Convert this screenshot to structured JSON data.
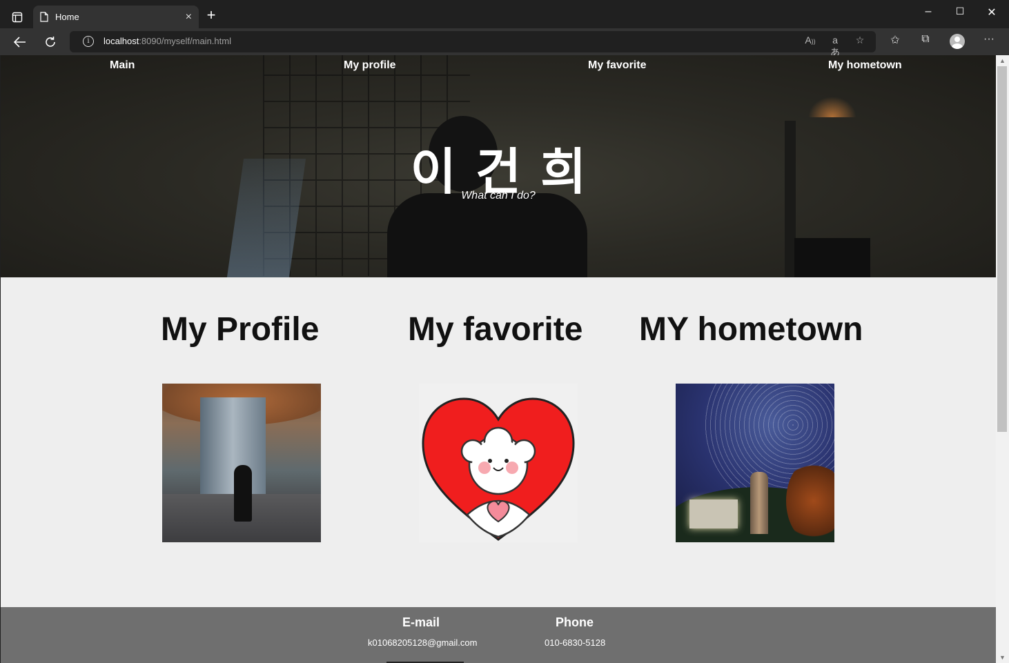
{
  "browser": {
    "tab_title": "Home",
    "close_glyph": "×",
    "new_tab_glyph": "+",
    "window_minimize": "–",
    "window_maximize": "☐",
    "window_close": "✕",
    "url_host": "localhost",
    "url_rest": ":8090/myself/main.html",
    "info_glyph": "i"
  },
  "nav": {
    "main": "Main",
    "profile": "My profile",
    "favorite": "My favorite",
    "hometown": "My hometown"
  },
  "hero": {
    "title": "이건희",
    "subtitle": "What can I do?"
  },
  "sections": {
    "profile": "My Profile",
    "favorite": "My favorite",
    "hometown": "MY hometown"
  },
  "footer": {
    "email_label": "E-mail",
    "email_value": "k01068205128@gmail.com",
    "phone_label": "Phone",
    "phone_value": "010-6830-5128"
  },
  "colors": {
    "page_bg": "#eeeeee",
    "footer_bg": "#6f6f6f",
    "heart_red": "#f01e1e",
    "chrome_dark": "#202020"
  },
  "icons": {
    "sidebar": "sidebar-toggle-icon",
    "tab": "document-icon",
    "back": "back-arrow-icon",
    "refresh": "refresh-icon",
    "info": "info-icon",
    "read_aloud": "read-aloud-icon",
    "translate": "translate-icon",
    "add_favorite": "add-favorite-icon",
    "favorites": "favorites-icon",
    "collections": "collections-icon",
    "profile": "profile-avatar-icon",
    "menu": "more-menu-icon"
  }
}
